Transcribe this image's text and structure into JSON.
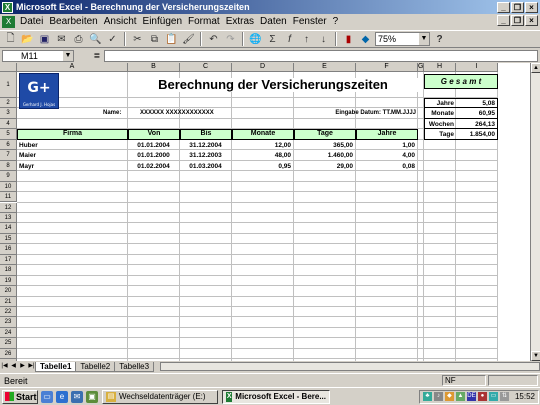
{
  "window": {
    "title": "Microsoft Excel - Berechnung der Versicherungszeiten"
  },
  "menu": [
    "Datei",
    "Bearbeiten",
    "Ansicht",
    "Einfügen",
    "Format",
    "Extras",
    "Daten",
    "Fenster",
    "?"
  ],
  "toolbar": {
    "zoom": "75%"
  },
  "formula_bar": {
    "name_box": "M11",
    "eq": "="
  },
  "columns": [
    "A",
    "B",
    "C",
    "D",
    "E",
    "F",
    "G",
    "H",
    "I"
  ],
  "rows": [
    "1",
    "2",
    "3",
    "4",
    "5",
    "6",
    "7",
    "8",
    "9",
    "10",
    "11",
    "12",
    "13",
    "14",
    "15",
    "16",
    "17",
    "18",
    "19",
    "20",
    "21",
    "22",
    "23",
    "24",
    "25",
    "26",
    "27",
    "28"
  ],
  "sheet": {
    "logo_text": "G+",
    "logo_caption": "Gerhard J. Hojas",
    "title": "Berechnung der Versicherungszeiten",
    "name_label": "Name:",
    "name_value": "XXXXXX XXXXXXXXXXXX",
    "input_label": "Eingabe Datum: TT.MM.JJJJ",
    "headers": [
      "Firma",
      "Von",
      "Bis",
      "Monate",
      "Tage",
      "Jahre"
    ],
    "rows": [
      [
        "Huber",
        "01.01.2004",
        "31.12.2004",
        "12,00",
        "365,00",
        "1,00"
      ],
      [
        "Maier",
        "01.01.2000",
        "31.12.2003",
        "48,00",
        "1.460,00",
        "4,00"
      ],
      [
        "Mayr",
        "01.02.2004",
        "01.03.2004",
        "0,95",
        "29,00",
        "0,08"
      ]
    ],
    "gesamt": {
      "title": "G e s a m t",
      "items": [
        {
          "label": "Jahre",
          "value": "5,08"
        },
        {
          "label": "Monate",
          "value": "60,95"
        },
        {
          "label": "Wochen",
          "value": "264,13"
        },
        {
          "label": "Tage",
          "value": "1.854,00"
        }
      ]
    }
  },
  "sheet_tabs": [
    "Tabelle1",
    "Tabelle2",
    "Tabelle3"
  ],
  "status": {
    "left": "Bereit",
    "mode": "NF"
  },
  "taskbar": {
    "start": "Start",
    "buttons": [
      "Wechseldatenträger (E:)",
      "Microsoft Excel - Bere..."
    ],
    "tray_lang": "DE",
    "clock": "15:52"
  }
}
